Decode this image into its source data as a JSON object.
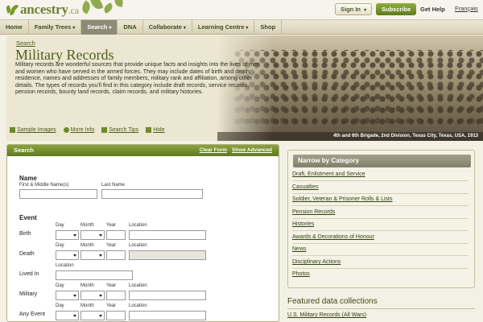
{
  "header": {
    "logo_text": "ancestry",
    "logo_suffix": ".ca",
    "signin_label": "Sign In",
    "subscribe_label": "Subscribe",
    "gethelp_label": "Get Help",
    "francais_label": "Français"
  },
  "nav": {
    "items": [
      {
        "label": "Home",
        "has_caret": false
      },
      {
        "label": "Family Trees",
        "has_caret": true
      },
      {
        "label": "Search",
        "has_caret": true,
        "active": true
      },
      {
        "label": "DNA",
        "has_caret": false
      },
      {
        "label": "Collaborate",
        "has_caret": true
      },
      {
        "label": "Learning Centre",
        "has_caret": true
      },
      {
        "label": "Shop",
        "has_caret": false
      }
    ]
  },
  "hero": {
    "breadcrumb": "Search",
    "title": "Military Records",
    "description": "Military records are wonderful sources that provide unique facts and insights into the lives of men and women who have served in the armed forces. They may include dates of birth and death, residence, names and addresses of family members, military rank and affiliation, among other details. The types of records you'll find in this category include draft records, service records, pension records, bounty land records, claim records, and military histories.",
    "caption": "4th and 6th Brigade, 2nd Division, Texas City, Texas, USA, 1913",
    "links": {
      "sample_images": "Sample Images",
      "more_info": "More Info",
      "search_tips": "Search Tips",
      "hide": "Hide"
    }
  },
  "search_form": {
    "title": "Search",
    "clear_form": "Clear Form",
    "show_advanced": "Show Advanced",
    "name_section": "Name",
    "first_name_label": "First & Middle Name(s)",
    "last_name_label": "Last Name",
    "event_section": "Event",
    "col_day": "Day",
    "col_month": "Month",
    "col_year": "Year",
    "col_location": "Location",
    "rows": {
      "birth": "Birth",
      "death": "Death",
      "lived_in": "Lived In",
      "military": "Military",
      "any_event": "Any Event"
    }
  },
  "narrow": {
    "title": "Narrow by Category",
    "categories": [
      "Draft, Enlistment and Service",
      "Casualties",
      "Soldier, Veteran & Prisoner Rolls & Lists",
      "Pension Records",
      "Histories",
      "Awards & Decorations of Honour",
      "News",
      "Disciplinary Actions",
      "Photos"
    ]
  },
  "featured": {
    "title": "Featured data collections",
    "items": [
      "U.S. Military Records (All Wars)"
    ]
  }
}
